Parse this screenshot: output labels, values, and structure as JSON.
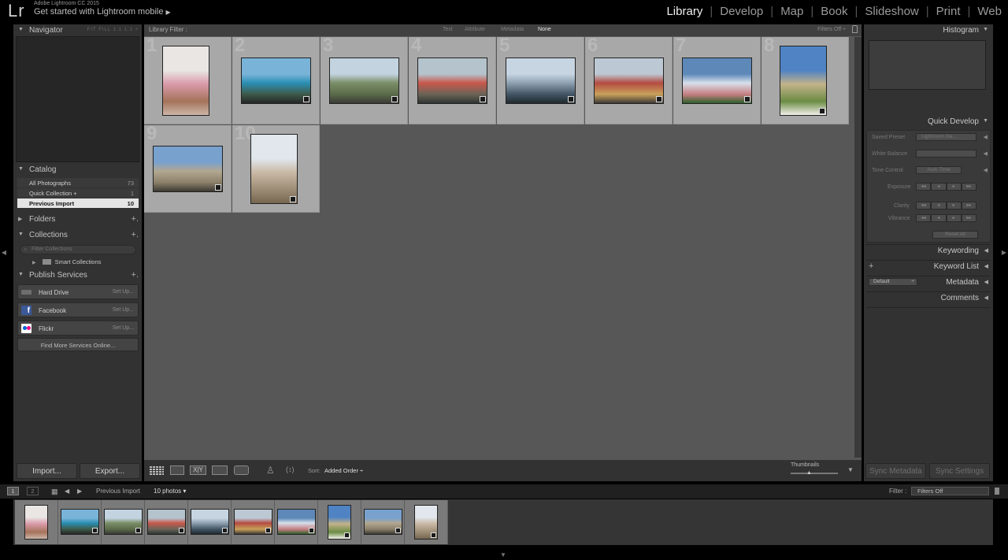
{
  "app": {
    "logo": "Lr",
    "version": "Adobe Lightroom CC 2015",
    "mobile_link": "Get started with Lightroom mobile",
    "mobile_arrow": "▶"
  },
  "modules": [
    "Library",
    "Develop",
    "Map",
    "Book",
    "Slideshow",
    "Print",
    "Web"
  ],
  "active_module": "Library",
  "left": {
    "navigator": {
      "title": "Navigator",
      "zoom_options": "FIT  FILL  1:1  1:1 ÷"
    },
    "catalog": {
      "title": "Catalog",
      "items": [
        {
          "label": "All Photographs",
          "count": "73"
        },
        {
          "label": "Quick Collection +",
          "count": "1"
        },
        {
          "label": "Previous Import",
          "count": "10"
        }
      ]
    },
    "folders": {
      "title": "Folders",
      "plus": "+."
    },
    "collections": {
      "title": "Collections",
      "plus": "+.",
      "filter_placeholder": "Filter Collections",
      "smart": "Smart Collections"
    },
    "publish": {
      "title": "Publish Services",
      "plus": "+.",
      "services": [
        {
          "name": "Hard Drive",
          "setup": "Set Up..."
        },
        {
          "name": "Facebook",
          "setup": "Set Up..."
        },
        {
          "name": "Flickr",
          "setup": "Set Up..."
        }
      ],
      "find_more": "Find More Services Online..."
    },
    "import_label": "Import...",
    "export_label": "Export..."
  },
  "filter_bar": {
    "title": "Library Filter :",
    "tabs": [
      "Text",
      "Attribute",
      "Metadata",
      "None"
    ],
    "active_tab": "None",
    "filters_off": "Filters Off ÷"
  },
  "grid": {
    "photos": [
      {
        "num": "1",
        "orient": "portrait",
        "colors": [
          "#e9e6e4",
          "#d99aa9",
          "#a5735a",
          "#cdb6a8"
        ]
      },
      {
        "num": "2",
        "orient": "landscape",
        "colors": [
          "#7ab3d8",
          "#2a8fb4",
          "#3d5a4a",
          "#262626"
        ]
      },
      {
        "num": "3",
        "orient": "landscape",
        "colors": [
          "#c3d3e0",
          "#7b8e68",
          "#5a6b49",
          "#3b3a36"
        ]
      },
      {
        "num": "4",
        "orient": "landscape",
        "colors": [
          "#b4c3cc",
          "#c9584c",
          "#6a6457",
          "#2f3532"
        ]
      },
      {
        "num": "5",
        "orient": "landscape",
        "colors": [
          "#c7d5e2",
          "#8fa1b1",
          "#425565",
          "#202a2f"
        ]
      },
      {
        "num": "6",
        "orient": "landscape",
        "colors": [
          "#bcc8d3",
          "#b44b41",
          "#c8a15a",
          "#3e3a36"
        ]
      },
      {
        "num": "7",
        "orient": "landscape",
        "colors": [
          "#5d88b8",
          "#d7e0ea",
          "#c67f83",
          "#2e5f2a"
        ]
      },
      {
        "num": "8",
        "orient": "portrait",
        "colors": [
          "#4f83c3",
          "#c3b28a",
          "#6b8c43",
          "#f1efe9"
        ]
      },
      {
        "num": "9",
        "orient": "landscape",
        "colors": [
          "#79a1ce",
          "#b2a790",
          "#8c806b",
          "#3d3a33"
        ]
      },
      {
        "num": "10",
        "orient": "portrait",
        "colors": [
          "#e1e7ed",
          "#c9b9a5",
          "#9d8c75",
          "#766751"
        ]
      }
    ]
  },
  "toolbar": {
    "sort_label": "Sort:",
    "sort_value": "Added Order ÷",
    "thumbnails_label": "Thumbnails"
  },
  "right": {
    "histogram_title": "Histogram",
    "quick_develop": {
      "title": "Quick Develop",
      "saved_preset_label": "Saved Preset",
      "saved_preset_value": "Lightroom Ge...",
      "white_balance_label": "White Balance",
      "tone_control_label": "Tone Control",
      "auto_tone": "Auto Tone",
      "exposure_label": "Exposure",
      "clarity_label": "Clarity",
      "vibrance_label": "Vibrance",
      "reset_all": "Reset All"
    },
    "keywording_title": "Keywording",
    "keyword_list_title": "Keyword List",
    "metadata_title": "Metadata",
    "metadata_preset": "Default",
    "comments_title": "Comments",
    "sync_metadata": "Sync Metadata",
    "sync_settings": "Sync Settings"
  },
  "filmstrip": {
    "view1": "1",
    "view2": "2",
    "source": "Previous Import",
    "count": "10 photos ▾",
    "filter_label": "Filter :",
    "filter_value": "Filters Off"
  }
}
